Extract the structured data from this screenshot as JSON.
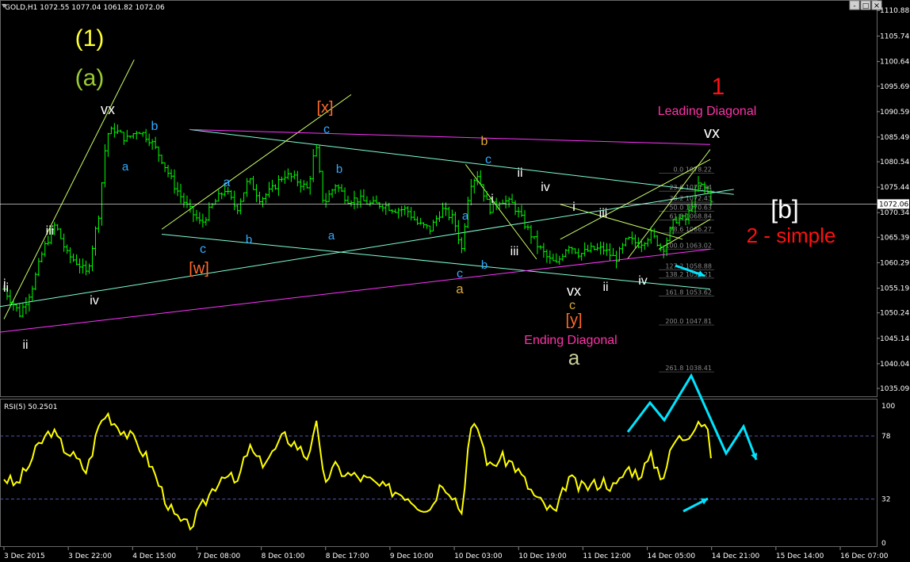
{
  "header": {
    "symbol_info": "GOLD,H1  1072.55 1077.04 1061.82 1072.06",
    "rsi_label": "RSI(5) 50.2501"
  },
  "window_buttons": {
    "minimize": "-",
    "maximize": "□",
    "close": "×"
  },
  "colors": {
    "background": "#000000",
    "candles": "#00ff00",
    "rsi": "#ffff00",
    "channel": "#7fffd4",
    "purple_line": "#ff33ff",
    "trendline": "#ccff66",
    "arrow": "#00e5ff",
    "current_price": "#ffffff"
  },
  "chart_data": [
    {
      "type": "candlestick",
      "title": "",
      "current_price": 1072.06,
      "ylim": [
        1033.5,
        1112.5
      ],
      "y_ticks": [
        1110.88,
        1105.74,
        1100.64,
        1095.69,
        1090.59,
        1085.49,
        1080.54,
        1075.44,
        1070.34,
        1065.39,
        1060.29,
        1055.19,
        1050.24,
        1045.14,
        1040.04,
        1035.09
      ],
      "x_ticks": [
        "3 Dec 2015",
        "3 Dec 22:00",
        "4 Dec 15:00",
        "7 Dec 08:00",
        "8 Dec 01:00",
        "8 Dec 17:00",
        "9 Dec 10:00",
        "10 Dec 03:00",
        "10 Dec 19:00",
        "11 Dec 12:00",
        "14 Dec 05:00",
        "14 Dec 21:00",
        "15 Dec 14:00",
        "16 Dec 07:00"
      ],
      "x_range": [
        0,
        220
      ],
      "close_path": [
        [
          0,
          1055
        ],
        [
          4,
          1050
        ],
        [
          7,
          1055
        ],
        [
          10,
          1063
        ],
        [
          13,
          1068
        ],
        [
          16,
          1062
        ],
        [
          19,
          1060
        ],
        [
          21,
          1058
        ],
        [
          24,
          1070
        ],
        [
          26,
          1086
        ],
        [
          28,
          1087
        ],
        [
          31,
          1085
        ],
        [
          34,
          1087
        ],
        [
          37,
          1085
        ],
        [
          40,
          1081
        ],
        [
          43,
          1076
        ],
        [
          46,
          1072
        ],
        [
          48,
          1070
        ],
        [
          50,
          1068
        ],
        [
          53,
          1072
        ],
        [
          56,
          1075
        ],
        [
          59,
          1071
        ],
        [
          62,
          1077
        ],
        [
          65,
          1073
        ],
        [
          68,
          1075
        ],
        [
          71,
          1078
        ],
        [
          74,
          1077
        ],
        [
          77,
          1075
        ],
        [
          79,
          1084
        ],
        [
          81,
          1072
        ],
        [
          84,
          1076
        ],
        [
          87,
          1073
        ],
        [
          90,
          1073
        ],
        [
          93,
          1072
        ],
        [
          96,
          1072
        ],
        [
          99,
          1071
        ],
        [
          102,
          1071
        ],
        [
          105,
          1068
        ],
        [
          108,
          1067
        ],
        [
          111,
          1071
        ],
        [
          114,
          1069
        ],
        [
          116,
          1063
        ],
        [
          118,
          1076
        ],
        [
          120,
          1078
        ],
        [
          123,
          1071
        ],
        [
          126,
          1073
        ],
        [
          129,
          1072
        ],
        [
          132,
          1068
        ],
        [
          135,
          1064
        ],
        [
          138,
          1061
        ],
        [
          140,
          1060
        ],
        [
          143,
          1064
        ],
        [
          146,
          1062
        ],
        [
          149,
          1063
        ],
        [
          152,
          1063
        ],
        [
          155,
          1061
        ],
        [
          158,
          1065
        ],
        [
          161,
          1064
        ],
        [
          164,
          1066
        ],
        [
          167,
          1063
        ],
        [
          170,
          1069
        ],
        [
          173,
          1069
        ],
        [
          176,
          1076
        ],
        [
          178,
          1075
        ],
        [
          180,
          1072
        ]
      ],
      "series": [
        {
          "name": "Channel",
          "points": [
            [
              -5,
              1051
            ],
            [
              185,
              1075
            ]
          ]
        },
        {
          "name": "Channel",
          "points": [
            [
              47,
              1087
            ],
            [
              185,
              1074
            ]
          ]
        },
        {
          "name": "Channel",
          "points": [
            [
              40,
              1066
            ],
            [
              179,
              1055
            ]
          ]
        },
        {
          "name": "Trendline",
          "points": [
            [
              0,
              1049
            ],
            [
              33,
              1101
            ]
          ]
        },
        {
          "name": "Trendline",
          "points": [
            [
              40,
              1067
            ],
            [
              88,
              1094
            ]
          ]
        },
        {
          "name": "Trendline",
          "points": [
            [
              158,
              1061
            ],
            [
              179,
              1083
            ]
          ]
        },
        {
          "name": "Trendline",
          "points": [
            [
              141,
              1065
            ],
            [
              179,
              1081
            ]
          ]
        },
        {
          "name": "Trendline",
          "points": [
            [
              117,
              1080
            ],
            [
              135,
              1061
            ]
          ]
        },
        {
          "name": "Trendline",
          "points": [
            [
              141,
              1072
            ],
            [
              172,
              1065
            ]
          ]
        },
        {
          "name": "Trendline",
          "points": [
            [
              166,
              1063
            ],
            [
              179,
              1069
            ]
          ]
        }
      ],
      "fibonacci": {
        "levels": [
          "0.0 1078.22",
          "23.6 1074.64",
          "38.2 1072.43",
          "50.0 1070.63",
          "61.8 1068.84",
          "78.6 1066.27",
          "100.0 1063.02",
          "127.2 1058.88",
          "138.2 1057.21",
          "161.8 1053.62",
          "200.0 1047.81",
          "261.8 1038.41"
        ]
      },
      "annotations": [
        "(1)",
        "(a)",
        "vx",
        "iii",
        "iv",
        "ii",
        "b",
        "a",
        "c",
        "b",
        "[w]",
        "a",
        "[x]",
        "c",
        "b",
        "a",
        "b",
        "c",
        "a",
        "c",
        "b",
        "a",
        "i",
        "iii",
        "ii",
        "iv",
        "vx",
        "c",
        "[y]",
        "Ending Diagonal",
        "a",
        "i",
        "iii",
        "ii",
        "iv",
        "1",
        "Leading Diagonal",
        "vx",
        "[b]",
        "2 - simple",
        "i",
        "ii"
      ]
    },
    {
      "type": "line",
      "title": "",
      "name": "RSI(5)",
      "current_value": 50.2501,
      "ylim": [
        0,
        100
      ],
      "y_ticks": [
        100,
        78,
        32,
        0
      ],
      "levels": [
        78,
        32
      ],
      "values": [
        [
          0,
          48
        ],
        [
          3,
          42
        ],
        [
          6,
          55
        ],
        [
          9,
          72
        ],
        [
          12,
          82
        ],
        [
          15,
          70
        ],
        [
          18,
          62
        ],
        [
          21,
          52
        ],
        [
          24,
          85
        ],
        [
          26,
          95
        ],
        [
          28,
          88
        ],
        [
          31,
          80
        ],
        [
          34,
          72
        ],
        [
          37,
          58
        ],
        [
          40,
          38
        ],
        [
          43,
          20
        ],
        [
          46,
          12
        ],
        [
          48,
          15
        ],
        [
          50,
          25
        ],
        [
          53,
          40
        ],
        [
          56,
          52
        ],
        [
          59,
          42
        ],
        [
          62,
          70
        ],
        [
          65,
          58
        ],
        [
          68,
          65
        ],
        [
          71,
          78
        ],
        [
          74,
          72
        ],
        [
          77,
          62
        ],
        [
          79,
          90
        ],
        [
          81,
          45
        ],
        [
          84,
          55
        ],
        [
          87,
          50
        ],
        [
          90,
          48
        ],
        [
          93,
          45
        ],
        [
          96,
          40
        ],
        [
          99,
          38
        ],
        [
          102,
          35
        ],
        [
          105,
          28
        ],
        [
          108,
          25
        ],
        [
          111,
          45
        ],
        [
          114,
          35
        ],
        [
          116,
          22
        ],
        [
          118,
          80
        ],
        [
          120,
          85
        ],
        [
          123,
          55
        ],
        [
          126,
          62
        ],
        [
          129,
          58
        ],
        [
          132,
          45
        ],
        [
          135,
          32
        ],
        [
          138,
          25
        ],
        [
          140,
          22
        ],
        [
          143,
          48
        ],
        [
          146,
          40
        ],
        [
          149,
          42
        ],
        [
          152,
          45
        ],
        [
          155,
          40
        ],
        [
          158,
          55
        ],
        [
          161,
          50
        ],
        [
          164,
          62
        ],
        [
          167,
          48
        ],
        [
          170,
          75
        ],
        [
          173,
          78
        ],
        [
          176,
          90
        ],
        [
          178,
          85
        ],
        [
          180,
          52
        ]
      ]
    }
  ]
}
